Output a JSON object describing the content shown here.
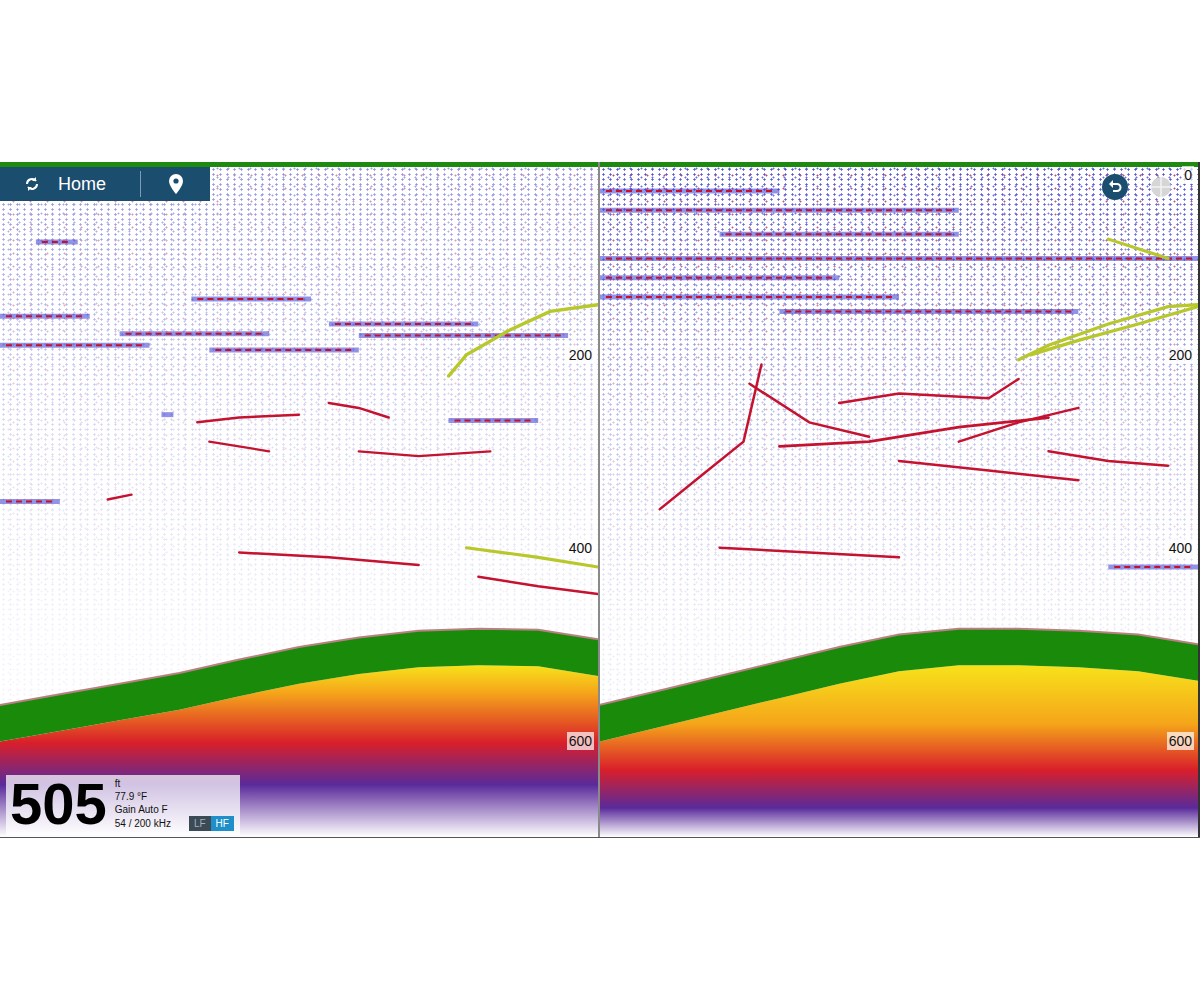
{
  "toolbar": {
    "home": "Home"
  },
  "readout": {
    "depth": "505",
    "unit": "ft",
    "temperature": "77.9 °F",
    "gain": "Gain Auto F",
    "frequency": "54 / 200 kHz"
  },
  "frequency_toggle": [
    {
      "label": "LF",
      "selected": false
    },
    {
      "label": "HF",
      "selected": true
    }
  ],
  "panels": [
    {
      "scale": [
        "200",
        "400",
        "600"
      ],
      "noise": 0.55,
      "bottom_strength": 0.85,
      "bottom": [
        563,
        552,
        541,
        530,
        516,
        503,
        493,
        486,
        484,
        485,
        495
      ],
      "streaks": [
        [
          6,
          13,
          83
        ],
        [
          32,
          52,
          142
        ],
        [
          0,
          15,
          160
        ],
        [
          20,
          45,
          178
        ],
        [
          55,
          80,
          168
        ],
        [
          0,
          25,
          190
        ],
        [
          35,
          60,
          195
        ],
        [
          27,
          29,
          262
        ],
        [
          0,
          10,
          352
        ],
        [
          75,
          90,
          268
        ],
        [
          60,
          95,
          180
        ]
      ],
      "traces": [
        {
          "strength": 0.9,
          "points": [
            [
              100,
              148
            ],
            [
              92,
              155
            ],
            [
              85,
              175
            ],
            [
              78,
              200
            ],
            [
              75,
              222
            ]
          ]
        },
        {
          "strength": 0.5,
          "points": [
            [
              33,
              270
            ],
            [
              40,
              265
            ],
            [
              50,
              262
            ]
          ]
        },
        {
          "strength": 0.5,
          "points": [
            [
              55,
              250
            ],
            [
              60,
              255
            ],
            [
              65,
              265
            ]
          ]
        },
        {
          "strength": 0.4,
          "points": [
            [
              35,
              290
            ],
            [
              45,
              300
            ]
          ]
        },
        {
          "strength": 0.4,
          "points": [
            [
              18,
              350
            ],
            [
              22,
              345
            ]
          ]
        },
        {
          "strength": 0.5,
          "points": [
            [
              40,
              405
            ],
            [
              55,
              410
            ],
            [
              70,
              418
            ]
          ]
        },
        {
          "strength": 0.8,
          "points": [
            [
              78,
              400
            ],
            [
              90,
              410
            ],
            [
              100,
              420
            ]
          ]
        },
        {
          "strength": 0.5,
          "points": [
            [
              80,
              430
            ],
            [
              90,
              440
            ],
            [
              100,
              448
            ]
          ]
        },
        {
          "strength": 0.4,
          "points": [
            [
              60,
              300
            ],
            [
              70,
              305
            ],
            [
              82,
              300
            ]
          ]
        }
      ]
    },
    {
      "scale": [
        "0",
        "200",
        "400",
        "600"
      ],
      "noise": 0.85,
      "bottom_strength": 0.4,
      "bottom": [
        563,
        548,
        533,
        518,
        503,
        490,
        484,
        484,
        486,
        490,
        500
      ],
      "streaks": [
        [
          0,
          30,
          30
        ],
        [
          0,
          60,
          50
        ],
        [
          20,
          60,
          75
        ],
        [
          0,
          100,
          100
        ],
        [
          0,
          50,
          140
        ],
        [
          30,
          80,
          155
        ],
        [
          0,
          40,
          120
        ],
        [
          85,
          100,
          420
        ]
      ],
      "traces": [
        {
          "strength": 0.9,
          "points": [
            [
              100,
              148
            ],
            [
              95,
              150
            ],
            [
              85,
              168
            ],
            [
              75,
              190
            ],
            [
              70,
              205
            ]
          ]
        },
        {
          "strength": 0.85,
          "points": [
            [
              100,
              150
            ],
            [
              90,
              168
            ],
            [
              80,
              185
            ],
            [
              72,
              200
            ]
          ]
        },
        {
          "strength": 0.5,
          "points": [
            [
              10,
              360
            ],
            [
              18,
              320
            ],
            [
              24,
              290
            ],
            [
              27,
              210
            ]
          ]
        },
        {
          "strength": 0.5,
          "points": [
            [
              25,
              230
            ],
            [
              35,
              270
            ],
            [
              45,
              285
            ]
          ]
        },
        {
          "strength": 0.6,
          "points": [
            [
              30,
              295
            ],
            [
              45,
              290
            ],
            [
              60,
              275
            ],
            [
              75,
              265
            ]
          ]
        },
        {
          "strength": 0.5,
          "points": [
            [
              40,
              250
            ],
            [
              50,
              240
            ],
            [
              65,
              245
            ],
            [
              70,
              225
            ]
          ]
        },
        {
          "strength": 0.5,
          "points": [
            [
              50,
              310
            ],
            [
              65,
              320
            ],
            [
              80,
              330
            ]
          ]
        },
        {
          "strength": 0.5,
          "points": [
            [
              20,
              400
            ],
            [
              35,
              405
            ],
            [
              50,
              410
            ]
          ]
        },
        {
          "strength": 0.5,
          "points": [
            [
              75,
              300
            ],
            [
              85,
              310
            ],
            [
              95,
              315
            ]
          ]
        },
        {
          "strength": 0.8,
          "points": [
            [
              85,
              80
            ],
            [
              90,
              90
            ],
            [
              95,
              100
            ]
          ]
        },
        {
          "strength": 0.5,
          "points": [
            [
              60,
              290
            ],
            [
              70,
              270
            ],
            [
              80,
              255
            ]
          ]
        }
      ]
    }
  ]
}
